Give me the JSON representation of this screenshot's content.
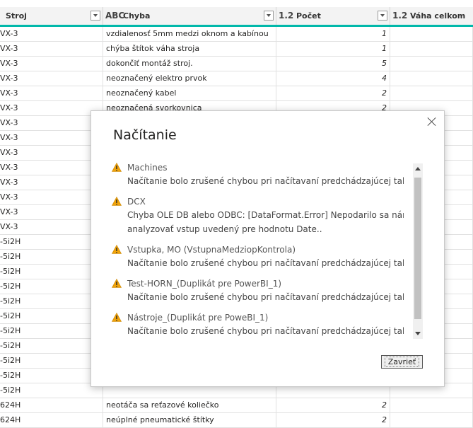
{
  "columns": [
    {
      "type": "ABC",
      "name": "Stroj"
    },
    {
      "type": "ABC",
      "name": "Chyba"
    },
    {
      "type": "1.2",
      "name": "Počet"
    },
    {
      "type": "1.2",
      "name": "Váha celkom"
    }
  ],
  "rows": [
    {
      "stroj": "VX-3",
      "chyba": "vzdialenosť 5mm medzi oknom a kabínou",
      "pocet": "1"
    },
    {
      "stroj": "VX-3",
      "chyba": "chýba štítok váha stroja",
      "pocet": "1"
    },
    {
      "stroj": "VX-3",
      "chyba": "dokončiť montáž stroj.",
      "pocet": "5"
    },
    {
      "stroj": "VX-3",
      "chyba": "neoznačený elektro prvok",
      "pocet": "4"
    },
    {
      "stroj": "VX-3",
      "chyba": "neoznačený kabel",
      "pocet": "2"
    },
    {
      "stroj": "VX-3",
      "chyba": "neoznačená svorkovnica",
      "pocet": "2"
    },
    {
      "stroj": "VX-3",
      "chyba": "",
      "pocet": ""
    },
    {
      "stroj": "VX-3",
      "chyba": "",
      "pocet": ""
    },
    {
      "stroj": "VX-3",
      "chyba": "",
      "pocet": ""
    },
    {
      "stroj": "VX-3",
      "chyba": "",
      "pocet": ""
    },
    {
      "stroj": "VX-3",
      "chyba": "",
      "pocet": ""
    },
    {
      "stroj": "VX-3",
      "chyba": "",
      "pocet": ""
    },
    {
      "stroj": "VX-3",
      "chyba": "",
      "pocet": ""
    },
    {
      "stroj": "VX-3",
      "chyba": "",
      "pocet": ""
    },
    {
      "stroj": "-5i2H",
      "chyba": "",
      "pocet": ""
    },
    {
      "stroj": "-5i2H",
      "chyba": "",
      "pocet": ""
    },
    {
      "stroj": "-5i2H",
      "chyba": "",
      "pocet": ""
    },
    {
      "stroj": "-5i2H",
      "chyba": "",
      "pocet": ""
    },
    {
      "stroj": "-5i2H",
      "chyba": "",
      "pocet": ""
    },
    {
      "stroj": "-5i2H",
      "chyba": "",
      "pocet": ""
    },
    {
      "stroj": "-5i2H",
      "chyba": "",
      "pocet": ""
    },
    {
      "stroj": "-5i2H",
      "chyba": "",
      "pocet": ""
    },
    {
      "stroj": "-5i2H",
      "chyba": "",
      "pocet": ""
    },
    {
      "stroj": "-5i2H",
      "chyba": "",
      "pocet": ""
    },
    {
      "stroj": "-5i2H",
      "chyba": "",
      "pocet": ""
    },
    {
      "stroj": "624H",
      "chyba": "neotáča sa reťazové koliečko",
      "pocet": "2"
    },
    {
      "stroj": "624H",
      "chyba": "neúplné pneumatické štítky",
      "pocet": "2"
    }
  ],
  "dialog": {
    "title": "Načítanie",
    "close_button": "Zavrieť",
    "items": [
      {
        "name": "Machines",
        "message": "Načítanie bolo zrušené chybou pri načítavaní predchádzajúcej tabuľky."
      },
      {
        "name": "DCX",
        "message": "Chyba OLE DB alebo ODBC: [DataFormat.Error] Nepodarilo sa nám",
        "message2": "analyzovať vstup uvedený pre hodnotu Date.."
      },
      {
        "name": "Vstupka, MO (VstupnaMedziopKontrola)",
        "message": "Načítanie bolo zrušené chybou pri načítavaní predchádzajúcej tabuľky."
      },
      {
        "name": "Test-HORN_(Duplikát pre PowerBI_1)",
        "message": "Načítanie bolo zrušené chybou pri načítavaní predchádzajúcej tabuľky."
      },
      {
        "name": "Nástroje_(Duplikát pre PoweBI_1)",
        "message": "Načítanie bolo zrušené chybou pri načítavaní predchádzajúcej tabuľky."
      }
    ]
  },
  "colors": {
    "accent": "#01b8aa",
    "warning": "#f0a30a"
  }
}
